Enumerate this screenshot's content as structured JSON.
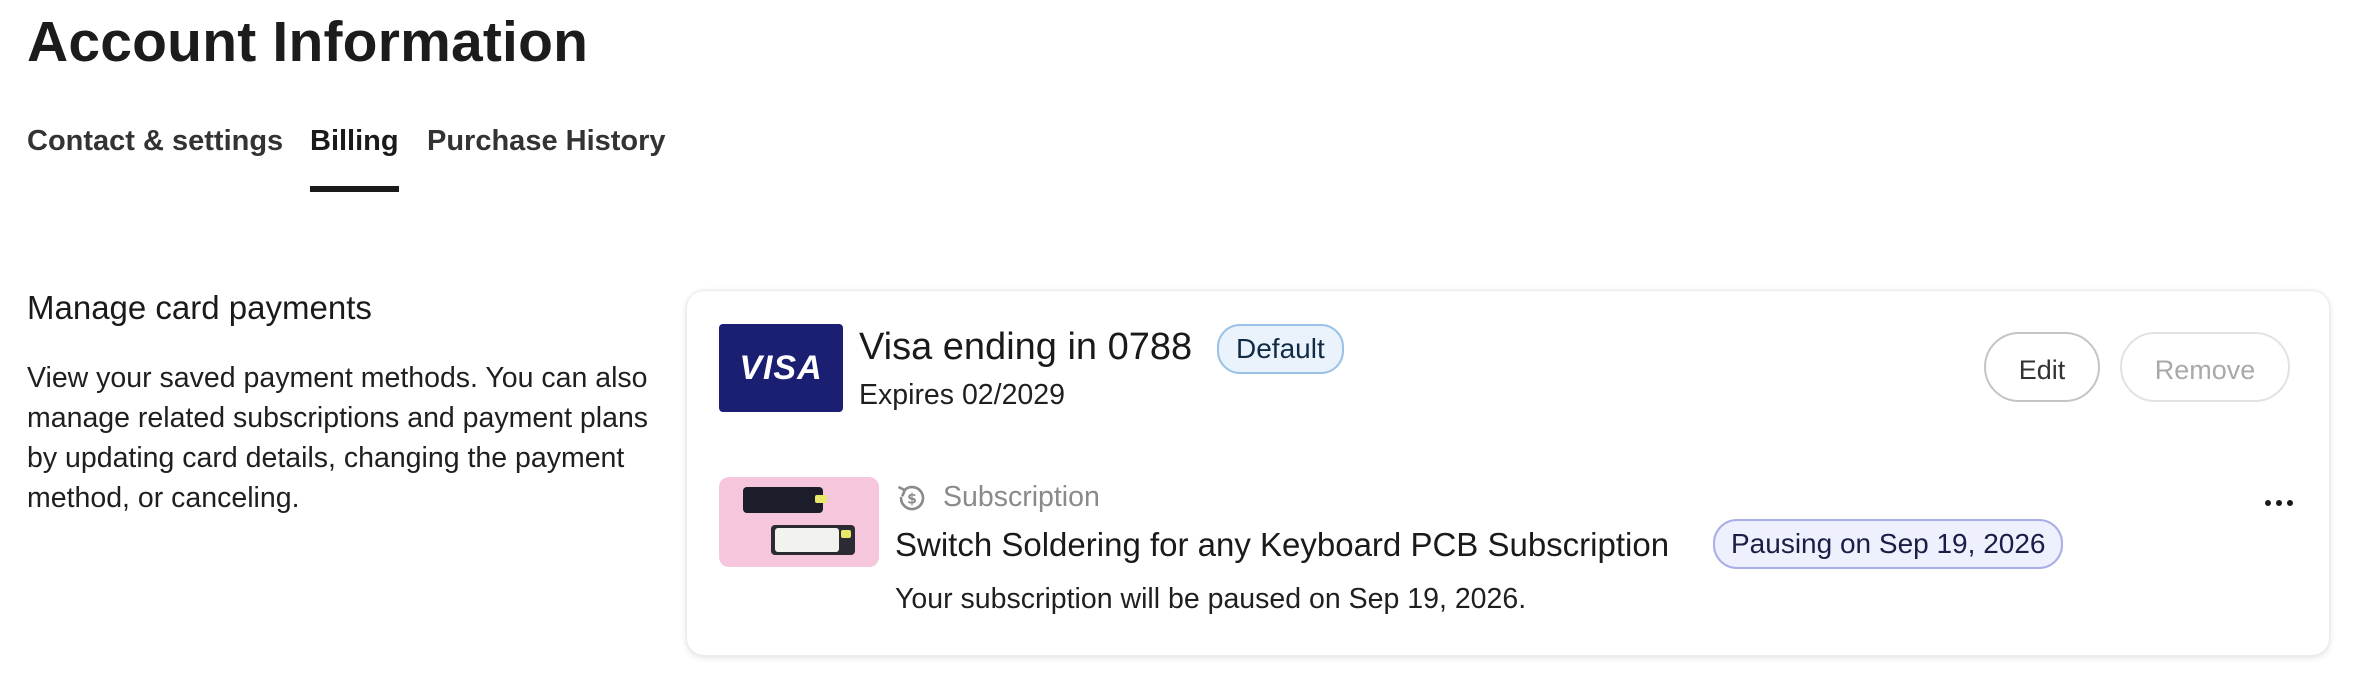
{
  "header": {
    "title": "Account Information"
  },
  "tabs": [
    {
      "label": "Contact & settings",
      "active": false
    },
    {
      "label": "Billing",
      "active": true
    },
    {
      "label": "Purchase History",
      "active": false
    }
  ],
  "section": {
    "title": "Manage card payments",
    "description": "View your saved payment methods. You can also manage related subscriptions and payment plans by updating card details, changing the payment method, or canceling."
  },
  "card": {
    "brand_logo_text": "VISA",
    "name": "Visa ending in 0788",
    "badge": "Default",
    "expires": "Expires 02/2029",
    "edit_label": "Edit",
    "remove_label": "Remove",
    "brand_color": "#1a1f71"
  },
  "subscription": {
    "type_label": "Subscription",
    "type_icon": "subscription-dollar-icon",
    "name": "Switch Soldering for any Keyboard PCB Subscription",
    "badge": "Pausing on Sep 19, 2026",
    "status": "Your subscription will be paused on Sep 19, 2026.",
    "more_icon": "more-horizontal-icon"
  }
}
